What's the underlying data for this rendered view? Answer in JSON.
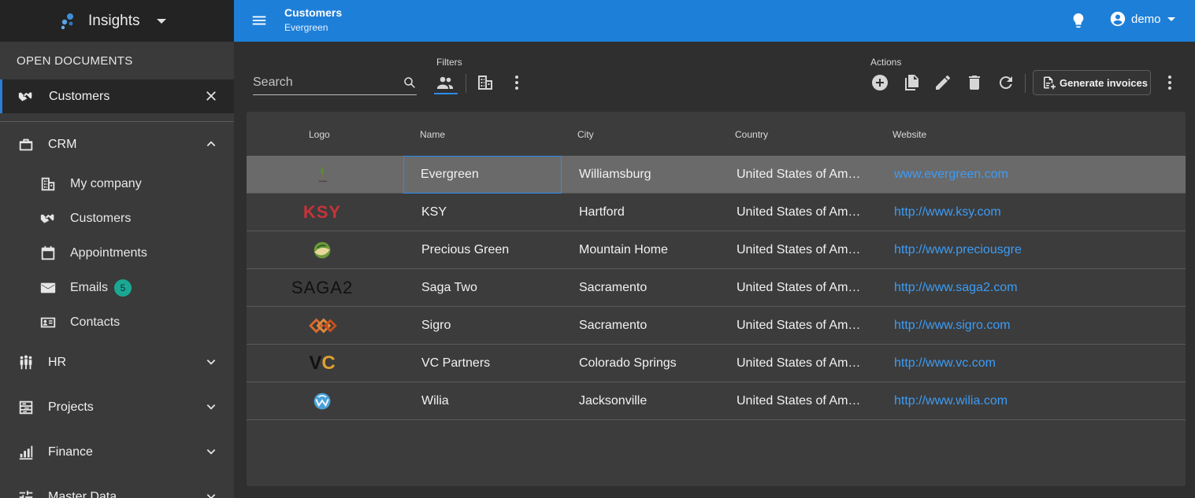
{
  "app": {
    "title": "Insights"
  },
  "sidebar": {
    "open_documents_heading": "OPEN DOCUMENTS",
    "open_document": {
      "label": "Customers"
    },
    "groups": [
      {
        "label": "CRM",
        "expanded": true,
        "items": [
          {
            "label": "My company"
          },
          {
            "label": "Customers"
          },
          {
            "label": "Appointments"
          },
          {
            "label": "Emails",
            "badge": "5"
          },
          {
            "label": "Contacts"
          }
        ]
      },
      {
        "label": "HR",
        "expanded": false
      },
      {
        "label": "Projects",
        "expanded": false
      },
      {
        "label": "Finance",
        "expanded": false
      },
      {
        "label": "Master Data",
        "expanded": false
      }
    ]
  },
  "header": {
    "title": "Customers",
    "subtitle": "Evergreen",
    "user": "demo",
    "color": "#1e7fd8"
  },
  "toolbar": {
    "search_placeholder": "Search",
    "filters_label": "Filters",
    "actions_label": "Actions",
    "generate_invoices_label": "Generate invoices"
  },
  "table": {
    "columns": [
      "Logo",
      "Name",
      "City",
      "Country",
      "Website"
    ],
    "rows": [
      {
        "logo": "evergreen-logo",
        "name": "Evergreen",
        "city": "Williamsburg",
        "country": "United States of Am…",
        "website": "www.evergreen.com",
        "selected": true
      },
      {
        "logo": "ksy-logo",
        "logo_text": "KSY",
        "name": "KSY",
        "city": "Hartford",
        "country": "United States of Am…",
        "website": "http://www.ksy.com"
      },
      {
        "logo": "precious-green-logo",
        "name": "Precious Green",
        "city": "Mountain Home",
        "country": "United States of Am…",
        "website": "http://www.preciousgre"
      },
      {
        "logo": "saga2-logo",
        "logo_text": "SAGA2",
        "name": "Saga Two",
        "city": "Sacramento",
        "country": "United States of Am…",
        "website": "http://www.saga2.com"
      },
      {
        "logo": "sigro-logo",
        "name": "Sigro",
        "city": "Sacramento",
        "country": "United States of Am…",
        "website": "http://www.sigro.com"
      },
      {
        "logo": "vc-logo",
        "logo_text": "VC",
        "name": "VC Partners",
        "city": "Colorado Springs",
        "country": "United States of Am…",
        "website": "http://www.vc.com"
      },
      {
        "logo": "wilia-logo",
        "name": "Wilia",
        "city": "Jacksonville",
        "country": "United States of Am…",
        "website": "http://www.wilia.com"
      }
    ]
  }
}
